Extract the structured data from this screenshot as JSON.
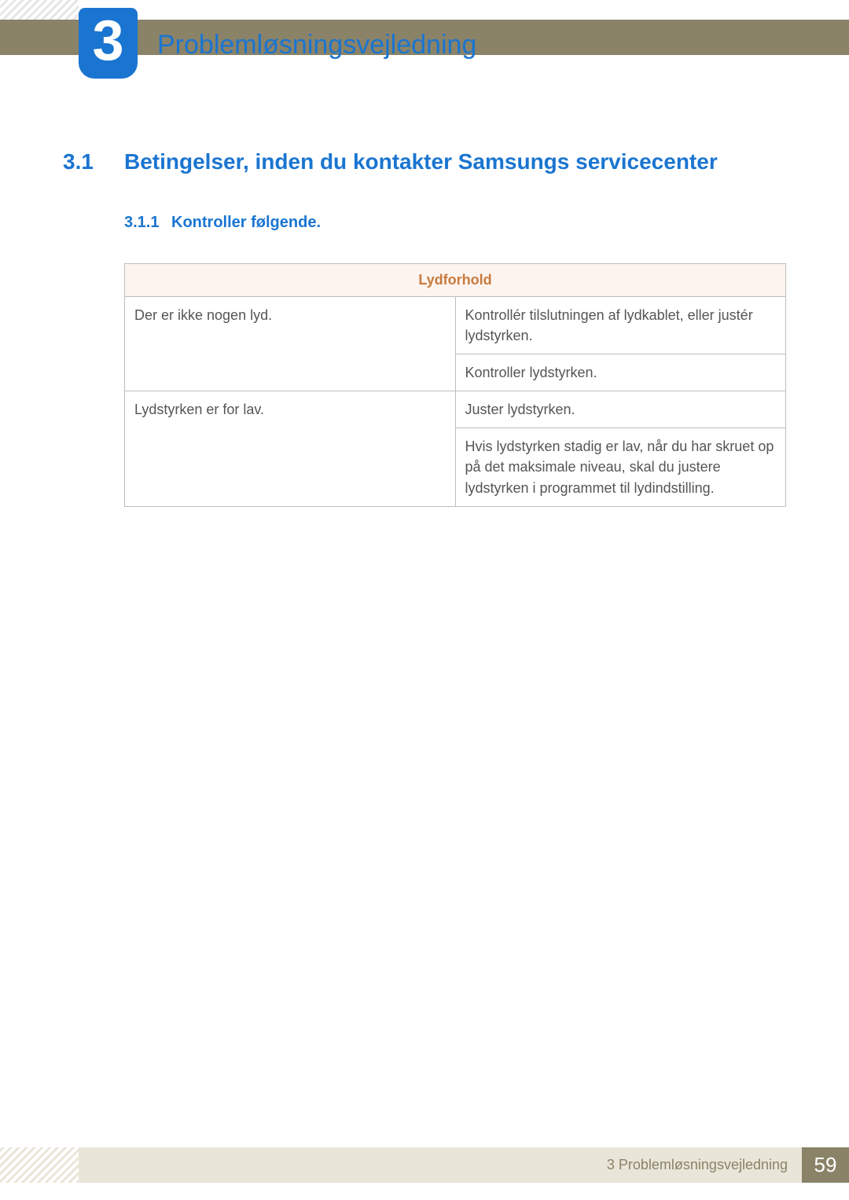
{
  "header": {
    "chapter_number": "3",
    "chapter_title": "Problemløsningsvejledning"
  },
  "section": {
    "number": "3.1",
    "title": "Betingelser, inden du kontakter Samsungs servicecenter"
  },
  "subsection": {
    "number": "3.1.1",
    "title": "Kontroller følgende."
  },
  "table": {
    "header": "Lydforhold",
    "rows": [
      {
        "problem": "Der er ikke nogen lyd.",
        "solutions": [
          "Kontrollér tilslutningen af lydkablet, eller justér lydstyrken.",
          "Kontroller lydstyrken."
        ]
      },
      {
        "problem": "Lydstyrken er for lav.",
        "solutions": [
          "Juster lydstyrken.",
          "Hvis lydstyrken stadig er lav, når du har skruet op på det maksimale niveau, skal du justere lydstyrken i programmet til lydindstilling."
        ]
      }
    ]
  },
  "footer": {
    "text": "3 Problemløsningsvejledning",
    "page": "59"
  }
}
